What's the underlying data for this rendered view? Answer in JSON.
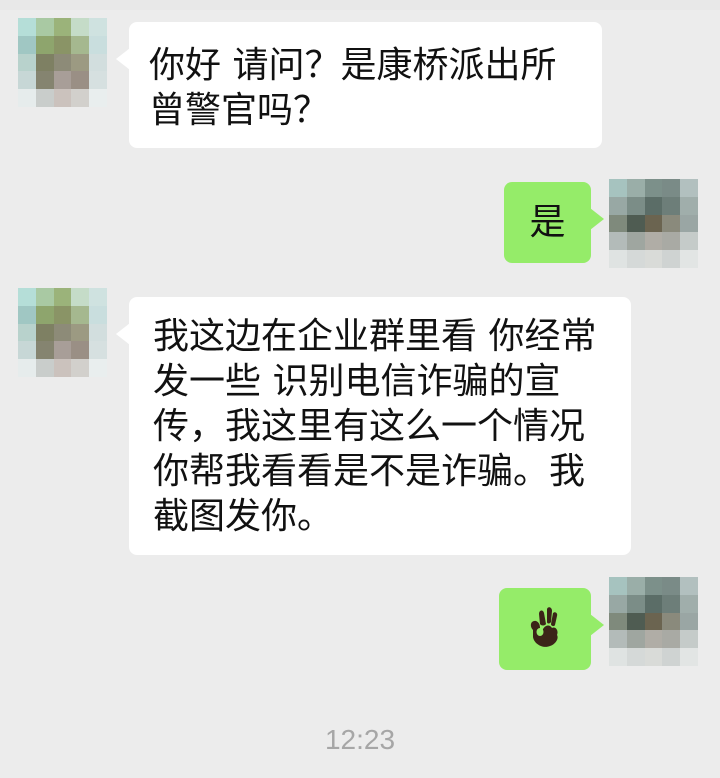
{
  "chat": {
    "messages": [
      {
        "side": "incoming",
        "text": "你好 请问？是康桥派出所\n曾警官吗？"
      },
      {
        "side": "outgoing",
        "text": "是"
      },
      {
        "side": "incoming",
        "text": "我这边在企业群里看 你经常\n发一些 识别电信诈骗的宣\n传，我这里有这么一个情况\n你帮我看看是不是诈骗。我\n截图发你。"
      },
      {
        "side": "outgoing",
        "emoji": "ok-hand-icon"
      }
    ],
    "timestamp": "12:23"
  },
  "avatars": {
    "incoming_palette": [
      "#b5ded8",
      "#a9c9a3",
      "#9bb37a",
      "#c5dcc8",
      "#cfe2e0",
      "#a0c7c3",
      "#8ea56d",
      "#8a9466",
      "#a5b88f",
      "#c9dede",
      "#b8d2cc",
      "#7e8063",
      "#8d8b78",
      "#9c9a82",
      "#d2dede",
      "#c7d7d6",
      "#858470",
      "#a89e98",
      "#9a8f85",
      "#d6e0e0",
      "#e6ecec",
      "#c9cdcb",
      "#cbc2bd",
      "#d2d0cc",
      "#e9eeee"
    ],
    "outgoing_palette": [
      "#a6c3bf",
      "#9aaea8",
      "#7c908a",
      "#7a8b87",
      "#b2c0bf",
      "#98a8a4",
      "#7b8d87",
      "#5b6d67",
      "#6d7e79",
      "#a0aeab",
      "#7f8a7c",
      "#4f5c52",
      "#6b6450",
      "#8a8a7c",
      "#9aa6a4",
      "#b3bbb9",
      "#9fa6a0",
      "#b0ada6",
      "#a9aaa4",
      "#c5cbc9",
      "#dfe3e2",
      "#d5d9d8",
      "#d9dbd8",
      "#cfd3d2",
      "#e2e5e4"
    ]
  }
}
